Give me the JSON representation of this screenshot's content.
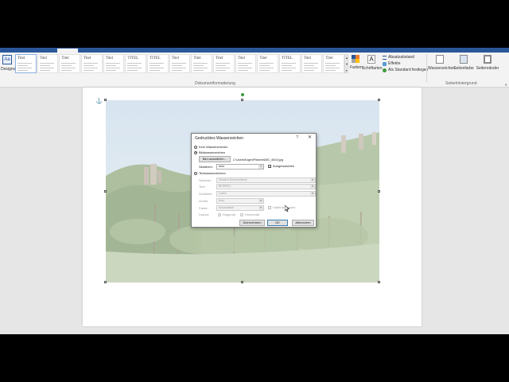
{
  "ribbon": {
    "designs_label": "Designs",
    "gallery": [
      "Titel",
      "Titel",
      "Titel",
      "Titel",
      "Titel",
      "TITEL",
      "TITEL",
      "Titel",
      "Titel",
      "Titel",
      "Titel",
      "Titel",
      "TITEL",
      "Titel",
      "Titel"
    ],
    "colors_label": "Farben",
    "fonts_label": "Schriftarten",
    "fonts_glyph": "A",
    "paragraph_spacing": "Absatzabstand",
    "effects": "Effekte",
    "set_default": "Als Standard festlegen",
    "group_formatting": "Dokumentformatierung",
    "watermark": "Wasserzeichen",
    "page_color": "Seitenfarbe",
    "page_borders": "Seitenränder",
    "group_background": "Seitenhintergrund",
    "brand_color": "#2b579a"
  },
  "dialog": {
    "title": "Gedrucktes Wasserzeichen",
    "help": "?",
    "close": "✕",
    "no_watermark": "Kein Wasserzeichen",
    "picture_watermark": "Bildwasserzeichen",
    "select_picture": "Bild auswählen...",
    "picture_path": "C:\\Users\\Eugen\\Pictures\\IMG_4547p.jpg",
    "scale_label": "Skalieren:",
    "scale_value": "Auto",
    "washout": "Ausgewaschen",
    "text_watermark": "Textwasserzeichen",
    "language_label": "Sprache:",
    "language_value": "Deutsch (Deutschland)",
    "text_label": "Text:",
    "text_value": "BEISPIEL",
    "font_label": "Schriftart:",
    "font_value": "Calibri",
    "size_label": "Größe:",
    "size_value": "Auto",
    "color_label": "Farbe:",
    "color_value": "Automatisch",
    "semitransparent": "Halbtransparent",
    "layout_label": "Layout:",
    "diagonal": "Diagonal",
    "horizontal": "Horizontal",
    "apply": "Übernehmen",
    "ok": "OK",
    "cancel": "Abbrechen"
  }
}
